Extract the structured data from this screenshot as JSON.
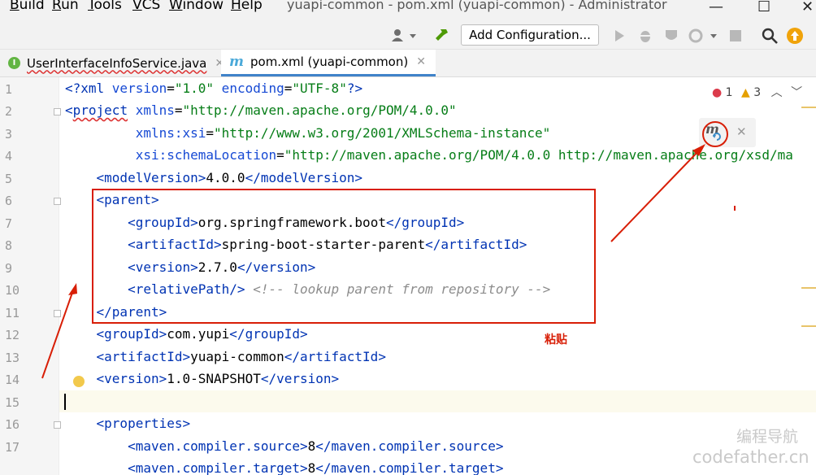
{
  "menu": [
    "Build",
    "Run",
    "Tools",
    "VCS",
    "Window",
    "Help"
  ],
  "menu_mnemonics": [
    "B",
    "R",
    "T",
    "V",
    "W",
    "H"
  ],
  "window_title": "yuapi-common - pom.xml (yuapi-common) - Administrator",
  "window_controls": {
    "minimize": "—",
    "maximize": "☐",
    "close": "✕"
  },
  "toolbar": {
    "add_configuration": "Add Configuration..."
  },
  "tabs": [
    {
      "label": "UserInterfaceInfoService.java",
      "icon": "interface-icon",
      "icon_text": "I",
      "active": false
    },
    {
      "label": "pom.xml (yuapi-common)",
      "icon": "maven-icon",
      "icon_text": "m",
      "active": true
    }
  ],
  "tab_close": "✕",
  "inspection": {
    "errors": "1",
    "warnings": "3"
  },
  "line_numbers": [
    "1",
    "2",
    "3",
    "4",
    "5",
    "6",
    "7",
    "8",
    "9",
    "10",
    "11",
    "12",
    "13",
    "14",
    "15",
    "16",
    "17"
  ],
  "code": {
    "l1": {
      "a": "<?xml ",
      "b": "version",
      "c": "=",
      "d": "\"1.0\"",
      "e": " encoding",
      "f": "=",
      "g": "\"UTF-8\"",
      "h": "?>"
    },
    "l2": {
      "a": "<",
      "b": "project",
      "c": " xmlns",
      "d": "=",
      "e": "\"http://maven.apache.org/POM/4.0.0\""
    },
    "l3": {
      "a": "         xmlns:xsi",
      "b": "=",
      "c": "\"http://www.w3.org/2001/XMLSchema-instance\""
    },
    "l4": {
      "a": "         xsi:schemaLocation",
      "b": "=",
      "c": "\"http://maven.apache.org/POM/4.0.0 http://maven.apache.org/xsd/ma"
    },
    "l5": {
      "a": "    <modelVersion>",
      "b": "4.0.0",
      "c": "</modelVersion>"
    },
    "l6": {
      "a": "    <parent>"
    },
    "l7": {
      "a": "        <groupId>",
      "b": "org.springframework.boot",
      "c": "</groupId>"
    },
    "l8": {
      "a": "        <artifactId>",
      "b": "spring-boot-starter-parent",
      "c": "</artifactId>"
    },
    "l9": {
      "a": "        <version>",
      "b": "2.7.0",
      "c": "</version>"
    },
    "l10": {
      "a": "        <relativePath/>",
      "b": " <!-- lookup parent from repository -->"
    },
    "l11": {
      "a": "    </parent>"
    },
    "l12": {
      "a": "    <groupId>",
      "b": "com.yupi",
      "c": "</groupId>"
    },
    "l13": {
      "a": "    <artifactId>",
      "b": "yuapi-common",
      "c": "</artifactId>"
    },
    "l14": {
      "a": "    <version>",
      "b": "1.0-SNAPSHOT",
      "c": "</version>"
    },
    "l15": {
      "a": ""
    },
    "l16": {
      "a": "    <properties>"
    },
    "l17": {
      "a": "        <maven.compiler.source>",
      "b": "8",
      "c": "</maven.compiler.source>"
    },
    "l18": {
      "a": "        <maven.compiler.target>",
      "b": "8",
      "c": "</maven.compiler.target>"
    }
  },
  "annotation": "粘贴",
  "maven_reload": {
    "icon_text": "m",
    "close": "✕"
  },
  "watermark": {
    "line1": "编程导航",
    "line2": "codefather.cn"
  },
  "colors": {
    "annotation_red": "#d81e06",
    "tab_underline": "#4083c9",
    "tag_blue": "#0033b3",
    "value_green": "#067d17"
  }
}
